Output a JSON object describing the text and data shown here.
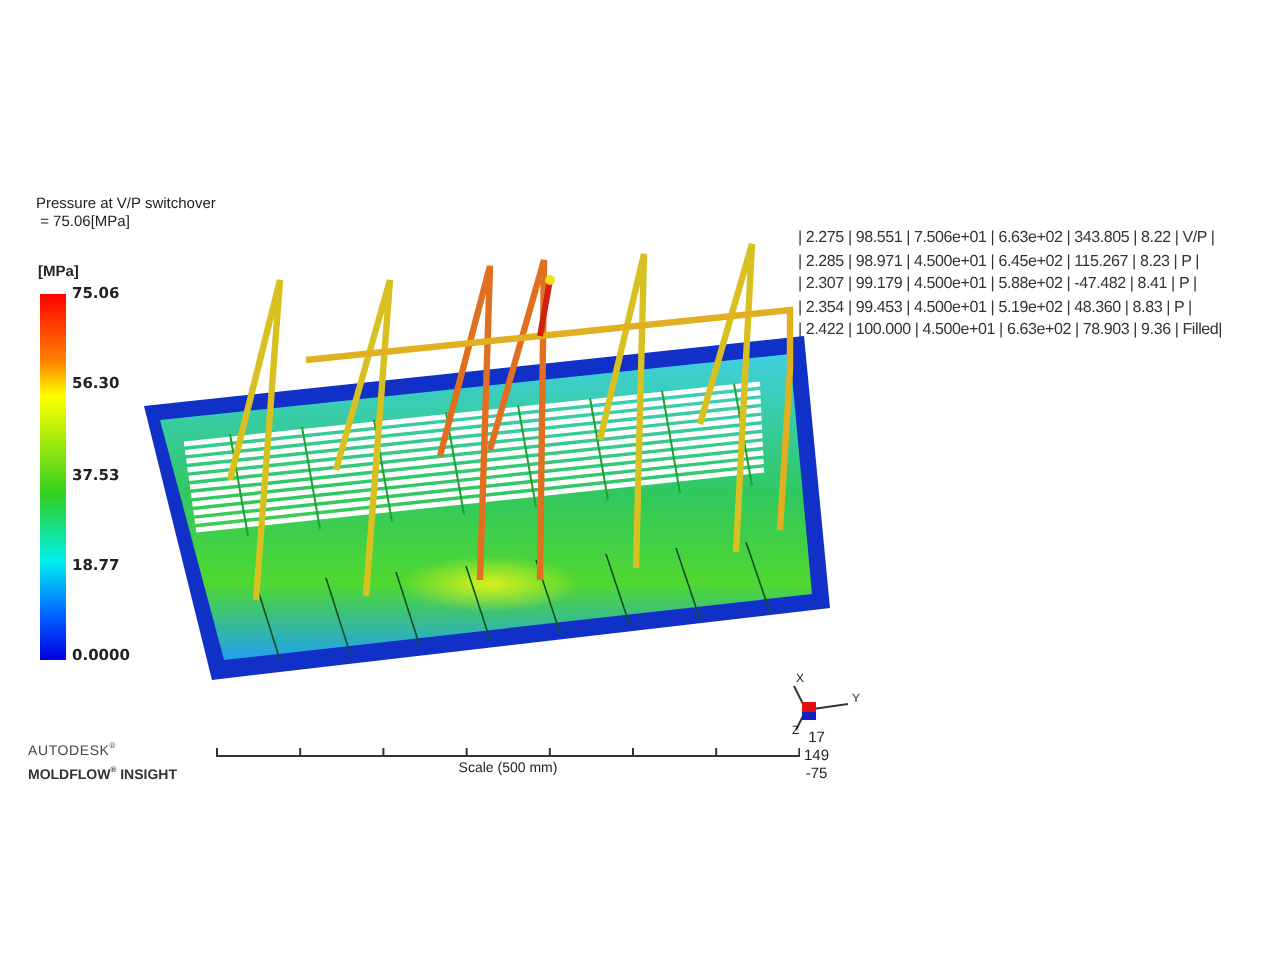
{
  "result_title": [
    "Pressure at V/P switchover",
    " = 75.06[MPa]"
  ],
  "legend": {
    "unit": "[MPa]",
    "labels": [
      "75.06",
      "56.30",
      "37.53",
      "18.77",
      "0.0000"
    ]
  },
  "table_rows": [
    "|  2.275 |  98.551 | 7.506e+01 | 6.63e+02 |  343.805 |   8.22 |  V/P  |",
    "|  2.285 |  98.971 | 4.500e+01 | 6.45e+02 |  115.267 |   8.23 |   P   |",
    "|  2.307 |  99.179 | 4.500e+01 | 5.88e+02 |  -47.482 |   8.41 |   P   |",
    "|  2.354 |  99.453 | 4.500e+01 | 5.19e+02 |   48.360 |   8.83 |   P   |",
    "|  2.422 | 100.000 | 4.500e+01 | 6.63e+02 |   78.903 |   9.36 | Filled|"
  ],
  "logo": {
    "brand": "AUTODESK$^{®}$",
    "product": "MOLDFLOW$^{®}$ INSIGHT"
  },
  "scale": {
    "label": "Scale (500 mm)"
  },
  "triad": {
    "axes": [
      "X",
      "Y",
      "Z"
    ],
    "angles": [
      "17",
      "149",
      "-75"
    ]
  }
}
